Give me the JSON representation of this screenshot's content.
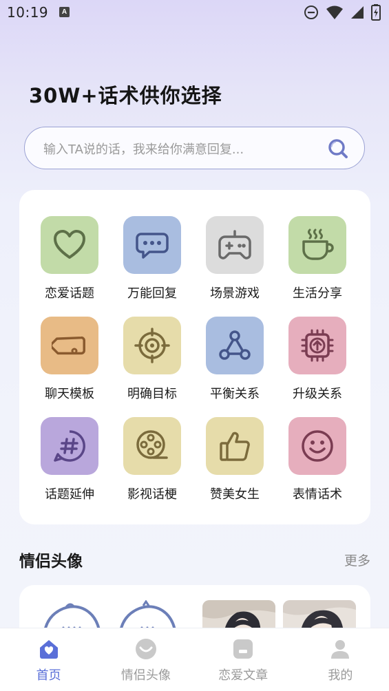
{
  "status_bar": {
    "time": "10:19",
    "notification_letter": "A"
  },
  "headline": "30W+话术供你选择",
  "search": {
    "placeholder": "输入TA说的话，我来给你满意回复..."
  },
  "features": [
    {
      "label": "恋爱话题",
      "icon": "heart-icon",
      "bg": "#c2dba8",
      "fg": "#5d7048"
    },
    {
      "label": "万能回复",
      "icon": "chat-bubble-icon",
      "bg": "#a9bde0",
      "fg": "#44558a"
    },
    {
      "label": "场景游戏",
      "icon": "gamepad-icon",
      "bg": "#dcdcdc",
      "fg": "#6a6a6a"
    },
    {
      "label": "生活分享",
      "icon": "coffee-cup-icon",
      "bg": "#c2dba8",
      "fg": "#5d7048"
    },
    {
      "label": "聊天模板",
      "icon": "tag-icon",
      "bg": "#e8bb86",
      "fg": "#8a5a2e"
    },
    {
      "label": "明确目标",
      "icon": "target-icon",
      "bg": "#e6dcaa",
      "fg": "#7b6b3c"
    },
    {
      "label": "平衡关系",
      "icon": "network-icon",
      "bg": "#a9bde0",
      "fg": "#44558a"
    },
    {
      "label": "升级关系",
      "icon": "upgrade-chip-icon",
      "bg": "#e6aebd",
      "fg": "#7a3c52"
    },
    {
      "label": "话题延伸",
      "icon": "hashtag-icon",
      "bg": "#b9a7dc",
      "fg": "#5a4688"
    },
    {
      "label": "影视话梗",
      "icon": "film-reel-icon",
      "bg": "#e6dcaa",
      "fg": "#7b6b3c"
    },
    {
      "label": "赞美女生",
      "icon": "thumbs-up-icon",
      "bg": "#e6dcaa",
      "fg": "#7b6b3c"
    },
    {
      "label": "表情话术",
      "icon": "smiley-icon",
      "bg": "#e6aebd",
      "fg": "#7a3c52"
    }
  ],
  "couple_avatars": {
    "title": "情侣头像",
    "more_label": "更多"
  },
  "tabbar": [
    {
      "label": "首页",
      "icon": "home-heart-icon",
      "active": true
    },
    {
      "label": "情侣头像",
      "icon": "couple-avatar-icon",
      "active": false
    },
    {
      "label": "恋爱文章",
      "icon": "article-icon",
      "active": false
    },
    {
      "label": "我的",
      "icon": "user-icon",
      "active": false
    }
  ],
  "colors": {
    "accent": "#5a6fd8",
    "tab_inactive": "#9a9a9a"
  }
}
